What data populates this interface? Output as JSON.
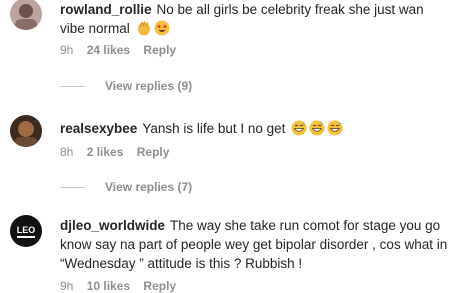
{
  "comments": [
    {
      "username": "rowland_rollie",
      "text": "No be all girls be celebrity freak she just wan vibe normal",
      "emojis": [
        "clapping-hands-icon",
        "star-struck-icon"
      ],
      "time": "9h",
      "likes": "24 likes",
      "reply_label": "Reply",
      "view_replies": "View replies (9)"
    },
    {
      "username": "realsexybee",
      "text": "Yansh is life but I no get",
      "emojis": [
        "grinning-sweat-icon",
        "grinning-sweat-icon",
        "grinning-sweat-icon"
      ],
      "time": "8h",
      "likes": "2 likes",
      "reply_label": "Reply",
      "view_replies": "View replies (7)"
    },
    {
      "username": "djleo_worldwide",
      "text": "The way she take run comot for stage you go know say na part of people wey get bipolar disorder , cos what in “Wednesday ” attitude is this ? Rubbish !",
      "time": "9h",
      "likes": "10 likes",
      "reply_label": "Reply",
      "avatar_logo_text": "LEO"
    }
  ],
  "colors": {
    "text": "#262626",
    "meta": "#8e8e8e",
    "divider": "#c7c7c7"
  }
}
